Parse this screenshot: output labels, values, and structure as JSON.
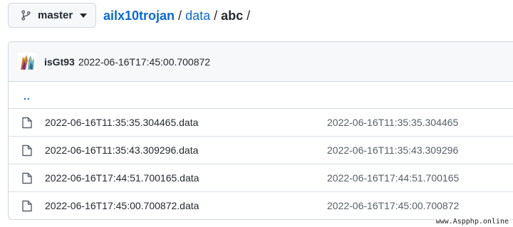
{
  "branch": {
    "label": "master",
    "icon": "git-branch-icon"
  },
  "breadcrumb": {
    "repo": "ailx10trojan",
    "separator": "/",
    "folder": "data",
    "current": "abc",
    "trailing": "/"
  },
  "latest_commit": {
    "author": "isGt93",
    "message": "2022-06-16T17:45:00.700872"
  },
  "parent_dir": "..",
  "files": [
    {
      "name": "2022-06-16T11:35:35.304465.data",
      "commit": "2022-06-16T11:35:35.304465"
    },
    {
      "name": "2022-06-16T11:35:43.309296.data",
      "commit": "2022-06-16T11:35:43.309296"
    },
    {
      "name": "2022-06-16T17:44:51.700165.data",
      "commit": "2022-06-16T17:44:51.700165"
    },
    {
      "name": "2022-06-16T17:45:00.700872.data",
      "commit": "2022-06-16T17:45:00.700872"
    }
  ],
  "watermark": "www.Aspphp.online",
  "colors": {
    "link": "#0969da",
    "text": "#24292f",
    "muted": "#57606a",
    "header_bg": "#f6f8fa",
    "border": "#d0d7de"
  }
}
